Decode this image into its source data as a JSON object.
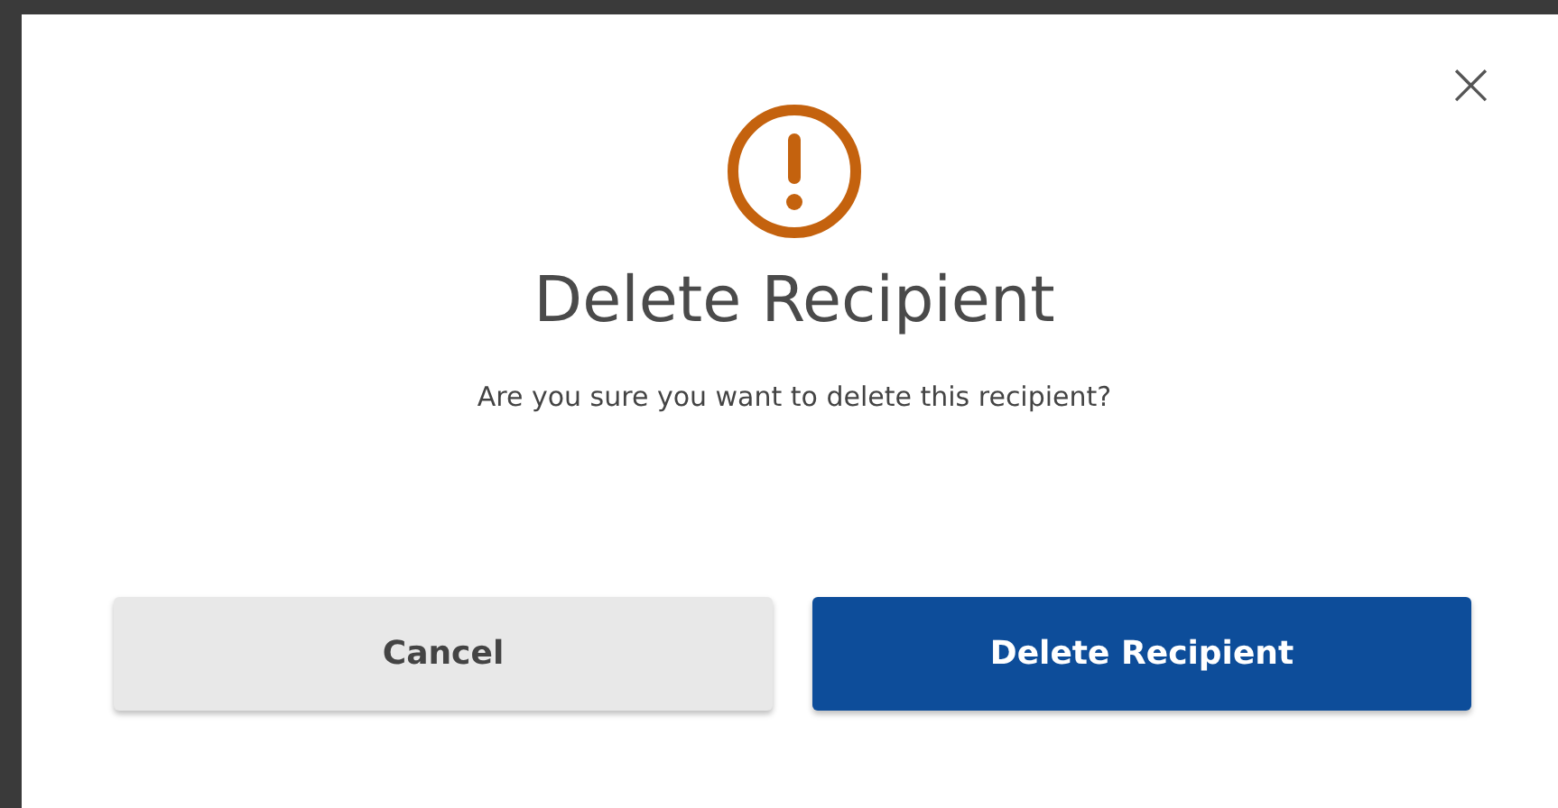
{
  "dialog": {
    "close_label": "×",
    "title": "Delete Recipient",
    "message": "Are you sure you want to delete this recipient?",
    "buttons": [
      {
        "label": "Cancel",
        "kind": "secondary"
      },
      {
        "label": "Delete Recipient",
        "kind": "primary"
      }
    ]
  }
}
